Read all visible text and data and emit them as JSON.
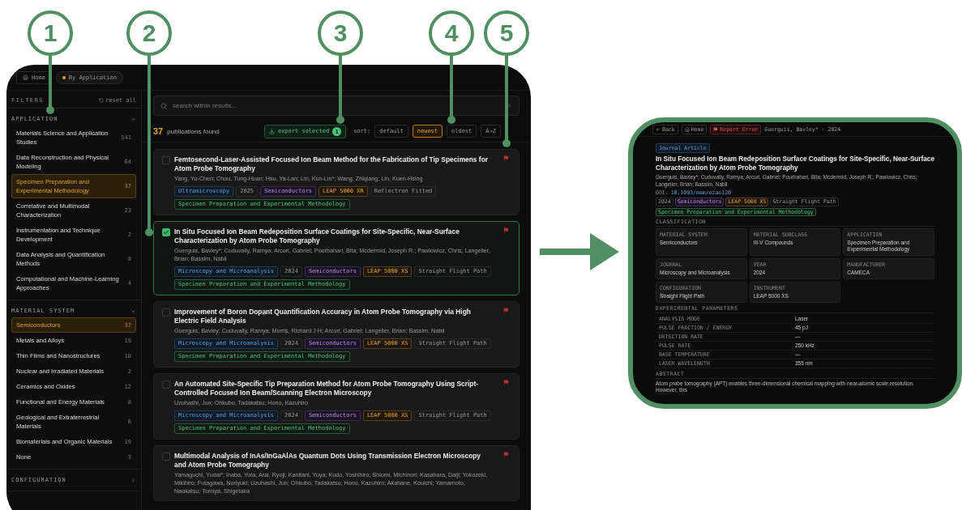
{
  "callouts": [
    {
      "label": "1"
    },
    {
      "label": "2"
    },
    {
      "label": "3"
    },
    {
      "label": "4"
    },
    {
      "label": "5"
    }
  ],
  "breadcrumbs": [
    {
      "label": "Home",
      "kind": "home"
    },
    {
      "label": "By Application",
      "kind": "current"
    }
  ],
  "sidebar": {
    "title": "FILTERS",
    "reset": "reset all",
    "sections": [
      {
        "title": "APPLICATION",
        "expanded": true,
        "items": [
          {
            "label": "Materials Science and Application Studies",
            "count": "541",
            "selected": false
          },
          {
            "label": "Data Reconstruction and Physical Modeling",
            "count": "64",
            "selected": false
          },
          {
            "label": "Specimen Preparation and Experimental Methodology",
            "count": "37",
            "selected": true
          },
          {
            "label": "Correlative and Multimodal Characterization",
            "count": "23",
            "selected": false
          },
          {
            "label": "Instrumentation and Technique Development",
            "count": "2",
            "selected": false
          },
          {
            "label": "Data Analysis and Quantification Methods",
            "count": "8",
            "selected": false
          },
          {
            "label": "Computational and Machine-Learning Approaches",
            "count": "4",
            "selected": false
          }
        ]
      },
      {
        "title": "MATERIAL SYSTEM",
        "expanded": true,
        "items": [
          {
            "label": "Semiconductors",
            "count": "37",
            "selected": true
          },
          {
            "label": "Metals and Alloys",
            "count": "19",
            "selected": false
          },
          {
            "label": "Thin Films and Nanostructures",
            "count": "18",
            "selected": false
          },
          {
            "label": "Nuclear and Irradiated Materials",
            "count": "2",
            "selected": false
          },
          {
            "label": "Ceramics and Oxides",
            "count": "12",
            "selected": false
          },
          {
            "label": "Functional and Energy Materials",
            "count": "8",
            "selected": false
          },
          {
            "label": "Geological and Extraterrestrial Materials",
            "count": "6",
            "selected": false
          },
          {
            "label": "Biomaterials and Organic Materials",
            "count": "19",
            "selected": false
          },
          {
            "label": "None",
            "count": "3",
            "selected": false
          }
        ]
      },
      {
        "title": "CONFIGURATION",
        "expanded": false
      }
    ]
  },
  "search": {
    "placeholder": "search within results..."
  },
  "results": {
    "count": "37",
    "label": "publications found",
    "export": {
      "label": "export selected",
      "count": "1"
    },
    "sort_label": "sort:",
    "sort_options": [
      {
        "label": "default",
        "selected": false
      },
      {
        "label": "newest",
        "selected": true
      },
      {
        "label": "oldest",
        "selected": false
      },
      {
        "label": "A→Z",
        "selected": false
      }
    ]
  },
  "publications": [
    {
      "checked": false,
      "title": "Femtosecond-Laser-Assisted Focused Ion Beam Method for the Fabrication of Tip Specimens for Atom Probe Tomography",
      "authors": "Yang, Yu-Chen; Chou, Tung-Huan; Hsu, Ya-Lan; Lin, Kun-Lin*; Wang, Zhiqiang; Lin, Kuen-Hsing",
      "tags": [
        {
          "kind": "journal",
          "text": "Ultramicroscopy"
        },
        {
          "kind": "plain",
          "text": "2025"
        },
        {
          "kind": "material",
          "text": "Semiconductors"
        },
        {
          "kind": "instrument",
          "text": "LEAP 5000 XR"
        },
        {
          "kind": "plain",
          "text": "Reflectron Fitted"
        },
        {
          "kind": "application",
          "text": "Specimen Preparation and Experimental Methodology"
        }
      ]
    },
    {
      "checked": true,
      "title": "In Situ Focused Ion Beam Redeposition Surface Coatings for Site-Specific, Near-Surface Characterization by Atom Probe Tomography",
      "authors": "Guerguis, Bavley*; Cuduvally, Ramya; Arcuri, Gabriel; Pourbahari, Bita; Mcdermid, Joseph R.; Pawlowicz, Chris; Langelier, Brian; Bassim, Nabil",
      "tags": [
        {
          "kind": "journal",
          "text": "Microscopy and Microanalysis"
        },
        {
          "kind": "plain",
          "text": "2024"
        },
        {
          "kind": "material",
          "text": "Semiconductors"
        },
        {
          "kind": "instrument",
          "text": "LEAP 5000 XS"
        },
        {
          "kind": "plain",
          "text": "Straight Flight Path"
        },
        {
          "kind": "application",
          "text": "Specimen Preparation and Experimental Methodology"
        }
      ]
    },
    {
      "checked": false,
      "title": "Improvement of Boron Dopant Quantification Accuracy in Atom Probe Tomography via High Electric Field Analysis",
      "authors": "Guerguis, Bavley; Cuduvally, Ramya; Morris, Richard J H; Arcuri, Gabriel; Langelier, Brian; Bassim, Nabil",
      "tags": [
        {
          "kind": "journal",
          "text": "Microscopy and Microanalysis"
        },
        {
          "kind": "plain",
          "text": "2024"
        },
        {
          "kind": "material",
          "text": "Semiconductors"
        },
        {
          "kind": "instrument",
          "text": "LEAP 5000 XS"
        },
        {
          "kind": "plain",
          "text": "Straight Flight Path"
        },
        {
          "kind": "application",
          "text": "Specimen Preparation and Experimental Methodology"
        }
      ]
    },
    {
      "checked": false,
      "title": "An Automated Site-Specific Tip Preparation Method for Atom Probe Tomography Using Script-Controlled Focused Ion Beam/Scanning Electron Microscopy",
      "authors": "Uzuhashi, Jun; Ohkubo, Tadakatsu; Hono, Kazuhiro",
      "tags": [
        {
          "kind": "journal",
          "text": "Microscopy and Microanalysis"
        },
        {
          "kind": "plain",
          "text": "2024"
        },
        {
          "kind": "material",
          "text": "Semiconductors"
        },
        {
          "kind": "instrument",
          "text": "LEAP 5000 XS"
        },
        {
          "kind": "plain",
          "text": "Straight Flight Path"
        },
        {
          "kind": "application",
          "text": "Specimen Preparation and Experimental Methodology"
        }
      ]
    },
    {
      "checked": false,
      "title": "Multimodal Analysis of InAs/InGaAlAs Quantum Dots Using Transmission Electron Microscopy and Atom Probe Tomography",
      "authors": "Yamaguchi, Yudai*; Inaba, Yuta; Arai, Ryoji; Kanitani, Yuya; Kudo, Yoshihiro; Shiomi, Michinori; Kasahara, Daiji; Yokozeki, Mikihiro; Futagawa, Noriyuki; Uzuhashi, Jun; Ohkubo, Tadakatsu; Hono, Kazuhiro; Akahane, Kouichi; Yamamoto, Naokatsu; Tomiya, Shigetaka"
    }
  ],
  "detail": {
    "nav": [
      {
        "label": "Back",
        "kind": "back"
      },
      {
        "label": "Home",
        "kind": "home"
      },
      {
        "label": "Report Error",
        "kind": "report"
      }
    ],
    "byline": "Guerguis, Bavley* · 2024",
    "type_badge": "Journal Article",
    "title": "In Situ Focused Ion Beam Redeposition Surface Coatings for Site-Specific, Near-Surface Characterization by Atom Probe Tomography",
    "authors": "Guerguis, Bavley*; Cuduvally, Ramya; Arcuri, Gabriel; Pourbahari, Bita; Mcdermid, Joseph R.; Pawlowicz, Chris; Langelier, Brian; Bassim, Nabil",
    "doi_label": "DOI:",
    "doi": "10.1093/mam/ozae120",
    "tags": [
      {
        "kind": "plain",
        "text": "2024"
      },
      {
        "kind": "material",
        "text": "Semiconductors"
      },
      {
        "kind": "instrument",
        "text": "LEAP 5000 XS"
      },
      {
        "kind": "plain",
        "text": "Straight Flight Path"
      },
      {
        "kind": "application",
        "text": "Specimen Preparation and Experimental Methodology"
      }
    ],
    "classification_title": "CLASSIFICATION",
    "classification": [
      {
        "label": "MATERIAL SYSTEM",
        "value": "Semiconductors"
      },
      {
        "label": "MATERIAL SUBCLASS",
        "value": "III-V Compounds"
      },
      {
        "label": "APPLICATION",
        "value": "Specimen Preparation and Experimental Methodology"
      },
      {
        "label": "JOURNAL",
        "value": "Microscopy and Microanalysis"
      },
      {
        "label": "YEAR",
        "value": "2024"
      },
      {
        "label": "MANUFACTURER",
        "value": "CAMECA"
      },
      {
        "label": "CONFIGURATION",
        "value": "Straight Flight Path"
      },
      {
        "label": "INSTRUMENT",
        "value": "LEAP 5000 XS"
      }
    ],
    "parameters_title": "EXPERIMENTAL PARAMETERS",
    "parameters": [
      {
        "label": "ANALYSIS MODE",
        "value": "Laser"
      },
      {
        "label": "PULSE FRACTION / ENERGY",
        "value": "45 pJ"
      },
      {
        "label": "DETECTION RATE",
        "value": "—"
      },
      {
        "label": "PULSE RATE",
        "value": "250 kHz"
      },
      {
        "label": "BASE TEMPERATURE",
        "value": "—"
      },
      {
        "label": "LASER WAVELENGTH",
        "value": "355 nm"
      }
    ],
    "abstract_title": "ABSTRACT",
    "abstract": "Atom probe tomography (APT) enables three-dimensional chemical mapping with near-atomic scale resolution. However, this"
  }
}
